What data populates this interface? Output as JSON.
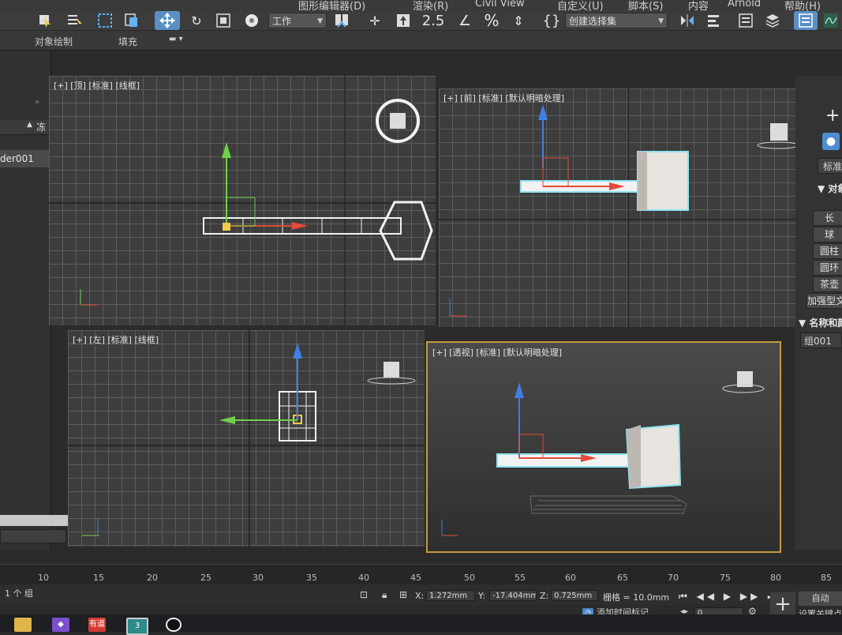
{
  "menu": [
    "图形编辑器(D)",
    "渲染(R)",
    "Civil View",
    "自定义(U)",
    "脚本(S)",
    "内容",
    "Arnold",
    "帮助(H)"
  ],
  "toolbar": {
    "workspace_dropdown": "工作",
    "selection_set_dropdown": "创建选择集",
    "snap_labels": [
      "2.5",
      "%"
    ]
  },
  "subtoolbar": {
    "object_paint": "对象绘制",
    "fill": "填充"
  },
  "left_panel": {
    "header_freeze": "冻",
    "selected_item": "der001"
  },
  "viewports": {
    "top": {
      "label": "[+] [顶] [标准] [线框]"
    },
    "front": {
      "label": "[+] [前] [标准] [默认明暗处理]"
    },
    "left": {
      "label": "[+] [左] [标准] [线框]"
    },
    "persp": {
      "label": "[+] [透视] [标准] [默认明暗处理]"
    }
  },
  "right_panel": {
    "plus": "+",
    "category_dropdown": "标准",
    "object_type_section": "▼ 对象",
    "buttons": [
      "长",
      "球",
      "圆柱",
      "圆环",
      "茶壶",
      "加强型文"
    ],
    "name_color_section": "▼ 名称和颜",
    "name_field": "组001"
  },
  "timeline": {
    "ticks": [
      "10",
      "15",
      "20",
      "25",
      "30",
      "35",
      "40",
      "45",
      "50",
      "55",
      "60",
      "65",
      "70",
      "75",
      "80",
      "85"
    ]
  },
  "status": {
    "selection": "1 个 组",
    "x_label": "X:",
    "x_value": "1.272mm",
    "y_label": "Y:",
    "y_value": "-17.404mm",
    "z_label": "Z:",
    "z_value": "0.725mm",
    "grid": "栅格 = 10.0mm",
    "add_time_tag": "添加时间标记",
    "auto_key": "自动",
    "set_key": "设置关键点",
    "frame": "0"
  },
  "taskbar": {
    "icons": [
      "folder",
      "visual-studio",
      "youdao",
      "3ds-max",
      "other"
    ],
    "youdao_label": "有道",
    "max_label": "3"
  },
  "colors": {
    "accent": "#5a8fc4",
    "persp_border": "#c39a3c",
    "selection_cyan": "#8fe4f0",
    "axis_x": "#e34b3b",
    "axis_y": "#6fd14a",
    "axis_z": "#3f7fe0"
  }
}
